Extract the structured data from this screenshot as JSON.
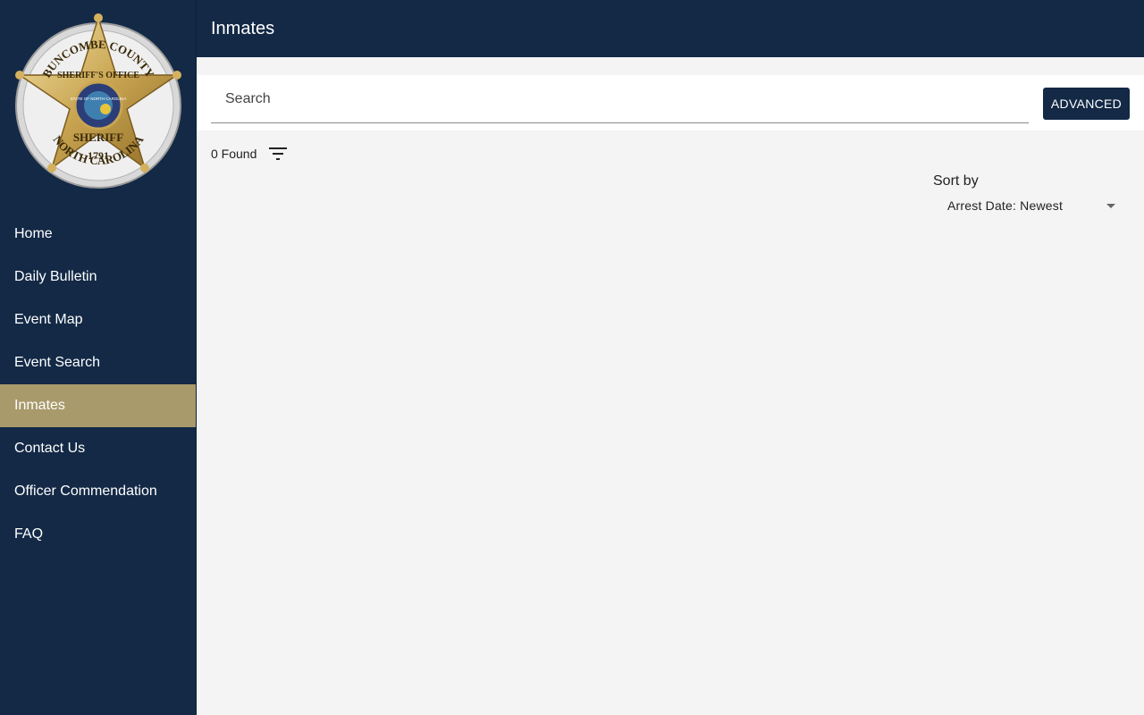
{
  "badge": {
    "top_text": "BUNCOMBE COUNTY",
    "office_text": "SHERIFF'S OFFICE",
    "seal_text": "STATE OF NORTH CAROLINA",
    "center_text": "SHERIFF",
    "year": "1791",
    "bottom_text": "NORTH CAROLINA"
  },
  "sidebar": {
    "items": [
      {
        "label": "Home",
        "active": false
      },
      {
        "label": "Daily Bulletin",
        "active": false
      },
      {
        "label": "Event Map",
        "active": false
      },
      {
        "label": "Event Search",
        "active": false
      },
      {
        "label": "Inmates",
        "active": true
      },
      {
        "label": "Contact Us",
        "active": false
      },
      {
        "label": "Officer Commendation",
        "active": false
      },
      {
        "label": "FAQ",
        "active": false
      }
    ]
  },
  "header": {
    "title": "Inmates"
  },
  "search": {
    "placeholder": "Search",
    "value": "",
    "advanced_label": "ADVANCED"
  },
  "results": {
    "found_label": "0 Found",
    "filter_icon": "filter-list-icon"
  },
  "sort": {
    "label": "Sort by",
    "selected": "Arrest Date: Newest",
    "caret_icon": "arrow-drop-down-icon"
  },
  "colors": {
    "navy": "#132946",
    "gold_active": "#a89a6b",
    "background": "#f4f4f4"
  }
}
